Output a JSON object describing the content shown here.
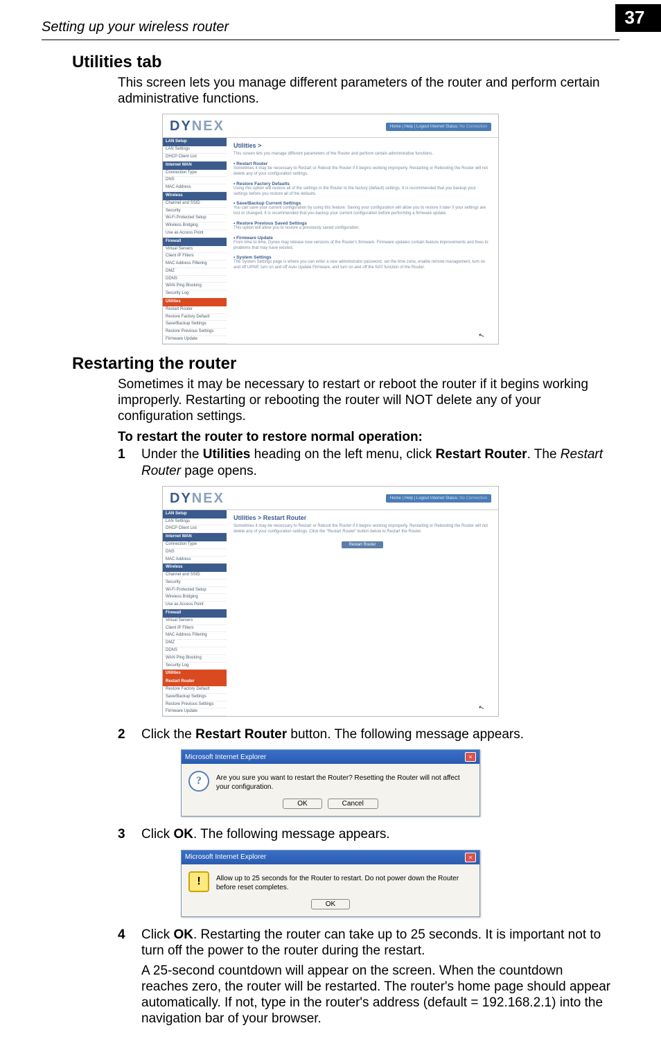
{
  "page": {
    "running_head": "Setting up your wireless router",
    "number": "37"
  },
  "utilities": {
    "heading": "Utilities tab",
    "intro": "This screen lets you manage different parameters of the router and perform certain administrative functions."
  },
  "restarting": {
    "heading": "Restarting the router",
    "intro": "Sometimes it may be necessary to restart or reboot the router if it begins working improperly. Restarting or rebooting the router will NOT delete any of your configuration settings.",
    "subhead": "To restart the router to restore normal operation:",
    "steps": {
      "s1_num": "1",
      "s1_a": "Under the ",
      "s1_b": "Utilities",
      "s1_c": " heading on the left menu, click ",
      "s1_d": "Restart Router",
      "s1_e": ". The ",
      "s1_f": "Restart Router",
      "s1_g": " page opens.",
      "s2_num": "2",
      "s2_a": "Click the ",
      "s2_b": "Restart Router",
      "s2_c": " button. The following message appears.",
      "s3_num": "3",
      "s3_a": "Click ",
      "s3_b": "OK",
      "s3_c": ". The following message appears.",
      "s4_num": "4",
      "s4_a": "Click ",
      "s4_b": "OK",
      "s4_c": ". Restarting the router can take up to 25 seconds. It is important not to turn off the power to the router during the restart."
    },
    "tail": "A 25-second countdown will appear on the screen. When the countdown reaches zero, the router will be restarted. The router's home page should appear automatically. If not, type in the router's address (default = 192.168.2.1) into the navigation bar of your browser."
  },
  "dynex": {
    "logo_a": "DY",
    "logo_b": "NEX",
    "status_a": "Home | Help | Logout   Internet Status: ",
    "status_b": "No Connection",
    "nav": {
      "hdr_lan": "LAN Setup",
      "lan1": "LAN Settings",
      "lan2": "DHCP Client List",
      "hdr_internet": "Internet WAN",
      "iw1": "Connection Type",
      "iw2": "DNS",
      "iw3": "MAC Address",
      "hdr_wireless": "Wireless",
      "w1": "Channel and SSID",
      "w2": "Security",
      "w3": "Wi-Fi Protected Setup",
      "w4": "Wireless Bridging",
      "w5": "Use as Access Point",
      "hdr_firewall": "Firewall",
      "f1": "Virtual Servers",
      "f2": "Client IP Filters",
      "f3": "MAC Address Filtering",
      "f4": "DMZ",
      "f5": "DDNS",
      "f6": "WAN Ping Blocking",
      "f7": "Security Log",
      "hdr_utilities": "Utilities",
      "u1": "Restart Router",
      "u2": "Restore Factory Default",
      "u3": "Save/Backup Settings",
      "u4": "Restore Previous Settings",
      "u5": "Firmware Update"
    },
    "utilities_page": {
      "title": "Utilities >",
      "intro": "This screen lets you manage different parameters of the Router and perform certain administrative functions.",
      "sect1_h": "• Restart Router",
      "sect1_t": "Sometimes it may be necessary to Restart or Reboot the Router if it begins working improperly. Restarting or Rebooting the Router will not delete any of your configuration settings.",
      "sect2_h": "• Restore Factory Defaults",
      "sect2_t": "Using this option will restore all of the settings in the Router to the factory (default) settings. It is recommended that you backup your settings before you restore all of the defaults.",
      "sect3_h": "• Save/Backup Current Settings",
      "sect3_t": "You can save your current configuration by using this feature. Saving your configuration will allow you to restore it later if your settings are lost or changed. It is recommended that you backup your current configuration before performing a firmware update.",
      "sect4_h": "• Restore Previous Saved Settings",
      "sect4_t": "This option will allow you to restore a previously saved configuration.",
      "sect5_h": "• Firmware Update",
      "sect5_t": "From time to time, Dynex may release new versions of the Router's firmware. Firmware updates contain feature improvements and fixes to problems that may have existed.",
      "sect6_h": "• System Settings",
      "sect6_t": "The System Settings page is where you can enter a new administrator password, set the time zone, enable remote management, turn on and off UPNP, turn on and off Auto Update Firmware, and turn on and off the NAT function of the Router."
    },
    "restart_page": {
      "title": "Utilities > Restart Router",
      "text": "Sometimes it may be necessary to Restart or Reboot the Router if it begins working improperly. Restarting or Rebooting the Router will not delete any of your configuration settings. Click the \"Restart Router\" button below to Restart the Router.",
      "button": "Restart Router"
    }
  },
  "dialog1": {
    "title": "Microsoft Internet Explorer",
    "msg": "Are you sure you want to restart the Router? Resetting the Router will not affect your configuration.",
    "ok": "OK",
    "cancel": "Cancel"
  },
  "dialog2": {
    "title": "Microsoft Internet Explorer",
    "msg": "Allow up to 25 seconds for the Router to restart. Do not power down the Router before reset completes.",
    "ok": "OK"
  }
}
